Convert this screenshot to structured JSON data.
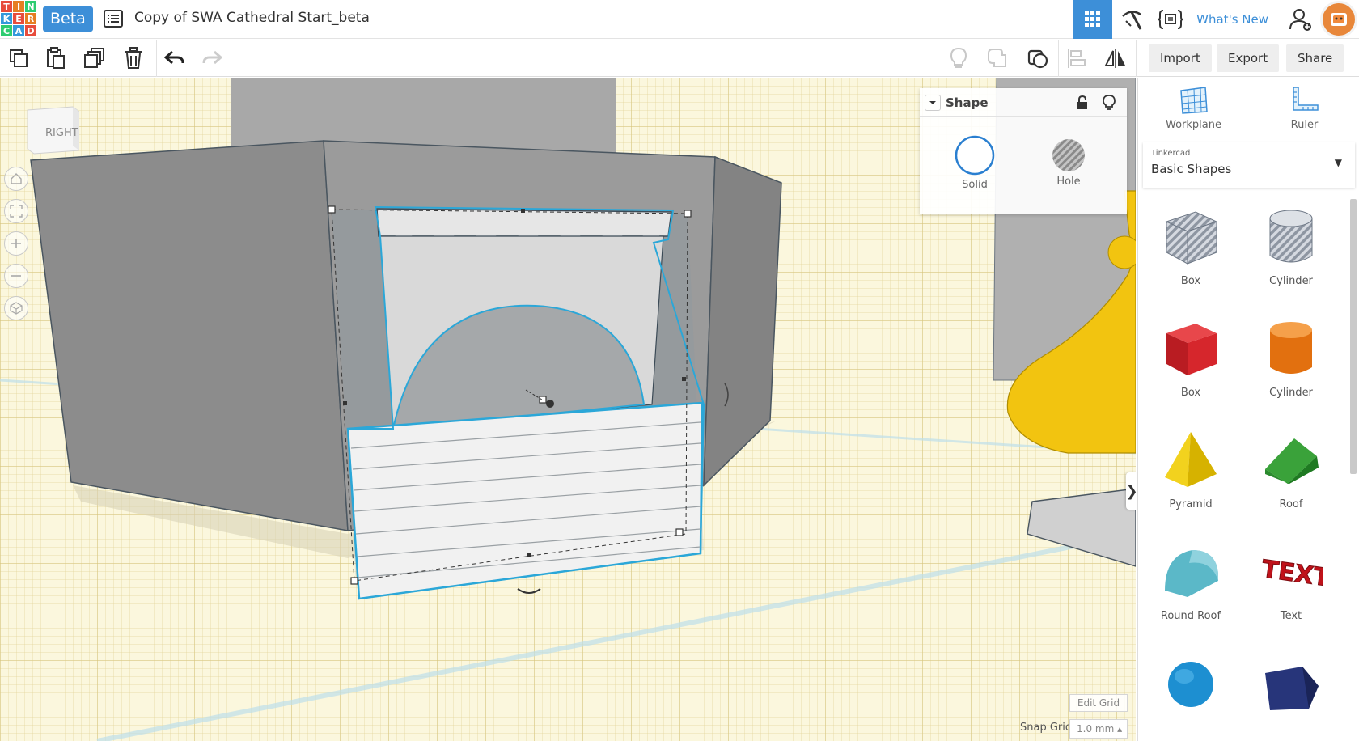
{
  "topbar": {
    "logo_letters": [
      "T",
      "I",
      "N",
      "K",
      "E",
      "R",
      "C",
      "A",
      "D"
    ],
    "logo_colors": [
      "#e74c3c",
      "#e67e22",
      "#2ecc71",
      "#3498db",
      "#e74c3c",
      "#e67e22",
      "#2ecc71",
      "#3498db",
      "#e74c3c"
    ],
    "beta": "Beta",
    "title": "Copy of SWA Cathedral Start_beta",
    "whats_new": "What's New"
  },
  "toolbar": {
    "import": "Import",
    "export": "Export",
    "share": "Share"
  },
  "viewport": {
    "viewcube_face": "RIGHT",
    "edit_grid": "Edit Grid",
    "snap_grid_label": "Snap Grid",
    "snap_grid_value": "1.0 mm ▴"
  },
  "inspector": {
    "title": "Shape",
    "solid": "Solid",
    "hole": "Hole"
  },
  "rightpanel": {
    "workplane": "Workplane",
    "ruler": "Ruler",
    "library_small": "Tinkercad",
    "library": "Basic Shapes",
    "shapes": [
      {
        "label": "Box",
        "icon": "box-hole-icon"
      },
      {
        "label": "Cylinder",
        "icon": "cylinder-hole-icon"
      },
      {
        "label": "Box",
        "icon": "box-icon"
      },
      {
        "label": "Cylinder",
        "icon": "cylinder-icon"
      },
      {
        "label": "Pyramid",
        "icon": "pyramid-icon"
      },
      {
        "label": "Roof",
        "icon": "roof-icon"
      },
      {
        "label": "Round Roof",
        "icon": "round-roof-icon"
      },
      {
        "label": "Text",
        "icon": "text-icon"
      },
      {
        "label": "",
        "icon": "sphere-icon"
      },
      {
        "label": "",
        "icon": "wedge-icon"
      }
    ],
    "text_icon_word": "TEXT"
  },
  "colors": {
    "accent": "#3d8fd8",
    "selection": "#2ba7d8",
    "grid": "#fbf7dd"
  }
}
